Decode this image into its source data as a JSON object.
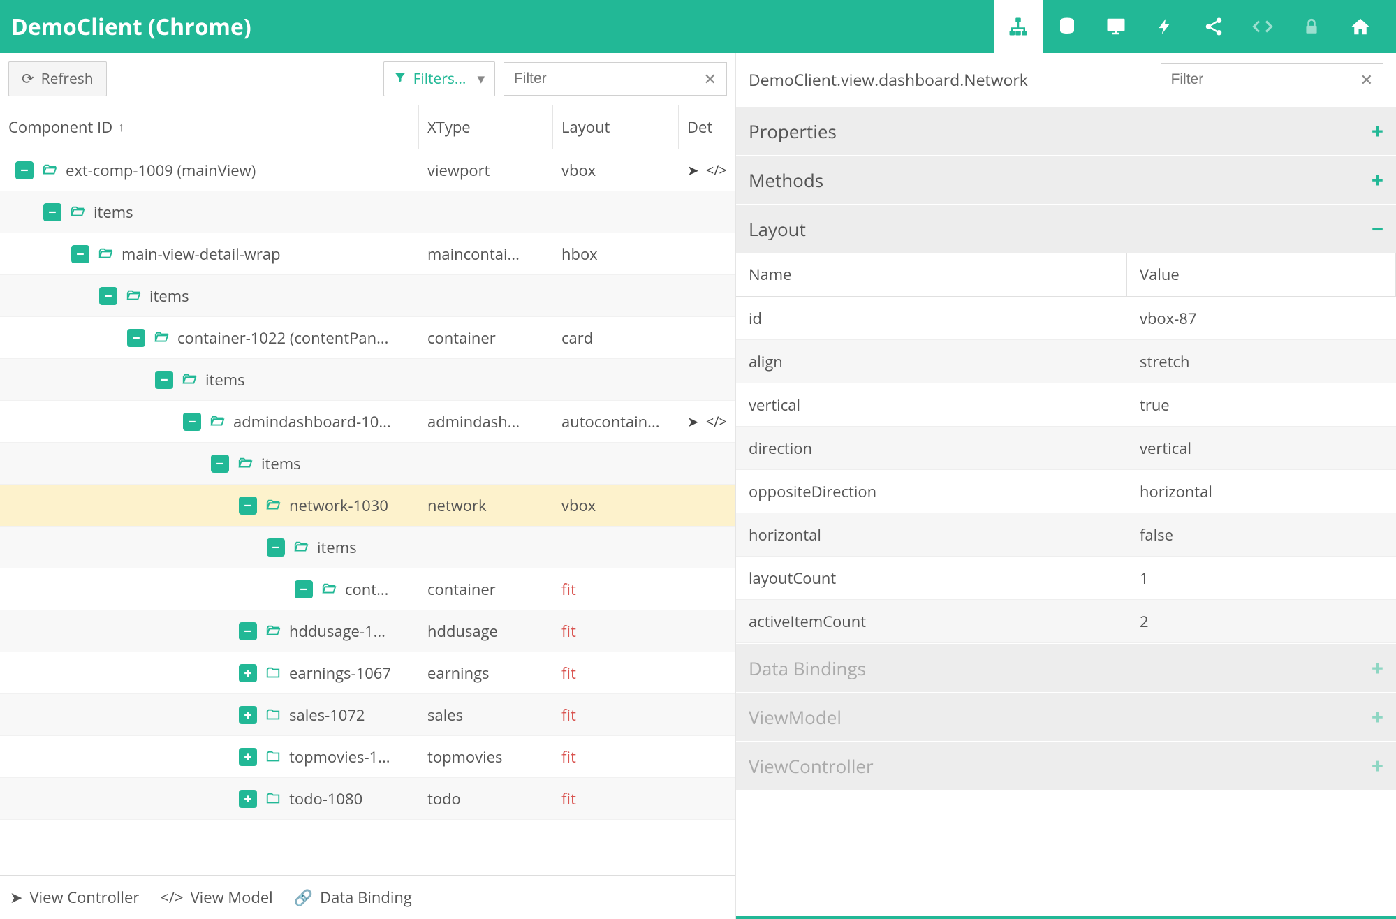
{
  "header": {
    "title": "DemoClient (Chrome)",
    "icons": [
      "sitemap",
      "database",
      "desktop",
      "bolt",
      "share",
      "code",
      "lock",
      "home"
    ]
  },
  "left": {
    "toolbar": {
      "refresh": "Refresh",
      "filters": "Filters...",
      "filter_placeholder": "Filter"
    },
    "columns": {
      "id": "Component ID",
      "xtype": "XType",
      "layout": "Layout",
      "det": "Det"
    },
    "tree": [
      {
        "indent": 0,
        "expand": "minus",
        "folder": "open",
        "label": "ext-comp-1009 (mainView)",
        "xtype": "viewport",
        "layout": "vbox",
        "det": true,
        "alt": false
      },
      {
        "indent": 1,
        "expand": "minus",
        "folder": "open",
        "label": "items",
        "xtype": "",
        "layout": "",
        "det": false,
        "alt": true
      },
      {
        "indent": 2,
        "expand": "minus",
        "folder": "open",
        "label": "main-view-detail-wrap",
        "xtype": "maincontai...",
        "layout": "hbox",
        "det": false,
        "alt": false
      },
      {
        "indent": 3,
        "expand": "minus",
        "folder": "open",
        "label": "items",
        "xtype": "",
        "layout": "",
        "det": false,
        "alt": true
      },
      {
        "indent": 4,
        "expand": "minus",
        "folder": "open",
        "label": "container-1022 (contentPan...",
        "xtype": "container",
        "layout": "card",
        "det": false,
        "alt": false
      },
      {
        "indent": 5,
        "expand": "minus",
        "folder": "open",
        "label": "items",
        "xtype": "",
        "layout": "",
        "det": false,
        "alt": true
      },
      {
        "indent": 6,
        "expand": "minus",
        "folder": "open",
        "label": "admindashboard-10...",
        "xtype": "admindash...",
        "layout": "autocontain...",
        "det": true,
        "alt": false
      },
      {
        "indent": 7,
        "expand": "minus",
        "folder": "open",
        "label": "items",
        "xtype": "",
        "layout": "",
        "det": false,
        "alt": true
      },
      {
        "indent": 8,
        "expand": "minus",
        "folder": "open",
        "label": "network-1030",
        "xtype": "network",
        "layout": "vbox",
        "det": false,
        "alt": false,
        "selected": true
      },
      {
        "indent": 9,
        "expand": "minus",
        "folder": "open",
        "label": "items",
        "xtype": "",
        "layout": "",
        "det": false,
        "alt": true
      },
      {
        "indent": 10,
        "expand": "minus",
        "folder": "open",
        "label": "cont...",
        "xtype": "container",
        "layout": "fit",
        "layoutRed": true,
        "det": false,
        "alt": false
      },
      {
        "indent": 8,
        "expand": "minus",
        "folder": "open",
        "label": "hddusage-1...",
        "xtype": "hddusage",
        "layout": "fit",
        "layoutRed": true,
        "det": false,
        "alt": true
      },
      {
        "indent": 8,
        "expand": "plus",
        "folder": "closed",
        "label": "earnings-1067",
        "xtype": "earnings",
        "layout": "fit",
        "layoutRed": true,
        "det": false,
        "alt": false
      },
      {
        "indent": 8,
        "expand": "plus",
        "folder": "closed",
        "label": "sales-1072",
        "xtype": "sales",
        "layout": "fit",
        "layoutRed": true,
        "det": false,
        "alt": true
      },
      {
        "indent": 8,
        "expand": "plus",
        "folder": "closed",
        "label": "topmovies-1...",
        "xtype": "topmovies",
        "layout": "fit",
        "layoutRed": true,
        "det": false,
        "alt": false
      },
      {
        "indent": 8,
        "expand": "plus",
        "folder": "closed",
        "label": "todo-1080",
        "xtype": "todo",
        "layout": "fit",
        "layoutRed": true,
        "det": false,
        "alt": true
      }
    ],
    "footer": {
      "vc": "View Controller",
      "vm": "View Model",
      "db": "Data Binding"
    }
  },
  "right": {
    "title": "DemoClient.view.dashboard.Network",
    "filter_placeholder": "Filter",
    "sections": [
      {
        "label": "Properties",
        "state": "plus",
        "dim": false
      },
      {
        "label": "Methods",
        "state": "plus",
        "dim": false
      },
      {
        "label": "Layout",
        "state": "minus",
        "dim": false
      },
      {
        "label": "Data Bindings",
        "state": "plus",
        "dim": true
      },
      {
        "label": "ViewModel",
        "state": "plus",
        "dim": true
      },
      {
        "label": "ViewController",
        "state": "plus",
        "dim": true
      }
    ],
    "prop_columns": {
      "name": "Name",
      "value": "Value"
    },
    "layout_props": [
      {
        "name": "id",
        "value": "vbox-87",
        "alt": false
      },
      {
        "name": "align",
        "value": "stretch",
        "alt": true
      },
      {
        "name": "vertical",
        "value": "true",
        "alt": false
      },
      {
        "name": "direction",
        "value": "vertical",
        "alt": true
      },
      {
        "name": "oppositeDirection",
        "value": "horizontal",
        "alt": false
      },
      {
        "name": "horizontal",
        "value": "false",
        "alt": true
      },
      {
        "name": "layoutCount",
        "value": "1",
        "alt": false
      },
      {
        "name": "activeItemCount",
        "value": "2",
        "alt": true
      }
    ]
  }
}
